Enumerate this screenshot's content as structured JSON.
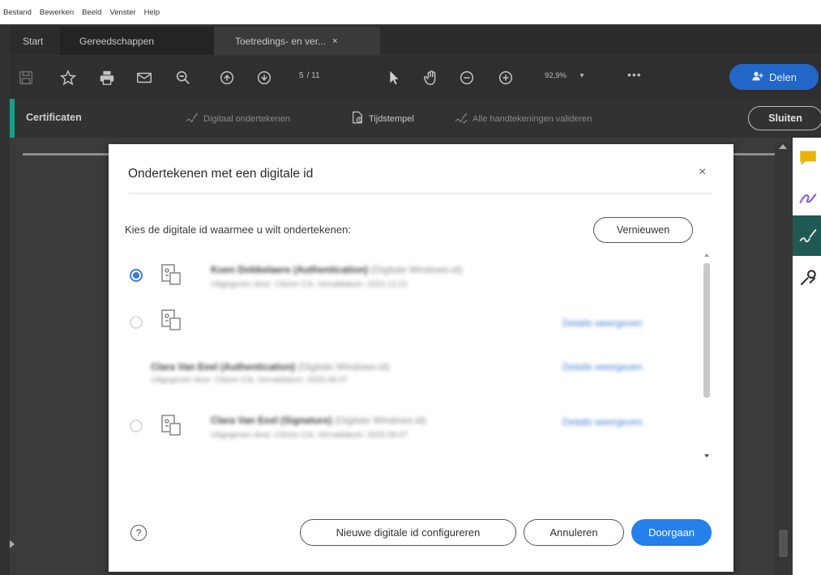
{
  "menu": [
    "Bestand",
    "Bewerken",
    "Beeld",
    "Venster",
    "Help"
  ],
  "tabs": {
    "start": "Start",
    "tools": "Gereedschappen",
    "document": "Toetredings- en ver...",
    "close_glyph": "×"
  },
  "toolbar": {
    "page_current": "5",
    "page_total": "/ 11",
    "zoom": "92,9%",
    "zoom_caret": "▾",
    "more": "•••",
    "share_label": "Delen",
    "icons": [
      "save-icon",
      "star-icon",
      "print-icon",
      "mail-icon",
      "zoom-search-icon",
      "page-up-icon",
      "page-down-icon",
      "select-arrow-icon",
      "hand-icon",
      "zoom-out-icon",
      "zoom-in-icon",
      "share-user-icon"
    ]
  },
  "certbar": {
    "title": "Certificaten",
    "digital_sign": "Digitaal ondertekenen",
    "timestamp": "Tijdstempel",
    "validate_all": "Alle handtekeningen valideren",
    "close_label": "Sluiten",
    "accent": "#17a089"
  },
  "dialog": {
    "title": "Ondertekenen met een digitale id",
    "close_glyph": "×",
    "prompt": "Kies de digitale id waarmee u wilt ondertekenen:",
    "refresh_label": "Vernieuwen",
    "ids": [
      {
        "name": "Koen Dobbelaere (Authentication)",
        "type": "(Digitale Windows-id)",
        "issuer": "Uitgegeven door: Citizen CA, Vervaldatum: 2024.12.21",
        "selected": true,
        "details": ""
      },
      {
        "name": "",
        "type": "",
        "issuer": "",
        "selected": false,
        "details": "Details weergeven"
      },
      {
        "name": "Clara Van Eeel (Authentication)",
        "type": "(Digitale Windows-id)",
        "issuer": "Uitgegeven door: Citizen CA, Vervaldatum: 2025.08.07",
        "selected": false,
        "details": "Details weergeven"
      },
      {
        "name": "Clara Van Eeel (Signature)",
        "type": "(Digitale Windows-id)",
        "issuer": "Uitgegeven door: Citizen CA, Vervaldatum: 2025.08.07",
        "selected": false,
        "details": "Details weergeven"
      }
    ],
    "help_glyph": "?",
    "new_id_label": "Nieuwe digitale id configureren",
    "cancel_label": "Annuleren",
    "continue_label": "Doorgaan",
    "primary_color": "#2680eb"
  }
}
